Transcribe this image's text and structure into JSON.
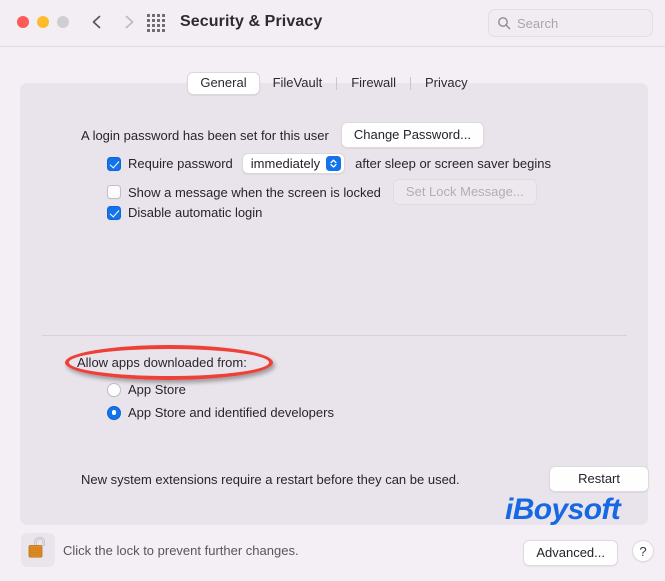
{
  "window": {
    "title": "Security & Privacy",
    "traffic_lights": [
      "close",
      "minimize",
      "zoom"
    ],
    "nav_back": "back-chevron",
    "nav_forward": "forward-chevron",
    "grid_button": "show-all-preferences",
    "search": {
      "placeholder": "Search",
      "value": "",
      "icon": "search-icon"
    }
  },
  "tabs": [
    {
      "label": "General",
      "selected": true
    },
    {
      "label": "FileVault",
      "selected": false
    },
    {
      "label": "Firewall",
      "selected": false
    },
    {
      "label": "Privacy",
      "selected": false
    }
  ],
  "general": {
    "login_password_text": "A login password has been set for this user",
    "change_password_button": "Change Password...",
    "require_password": {
      "checked": true,
      "label": "Require password",
      "delay_value": "immediately",
      "suffix": "after sleep or screen saver begins"
    },
    "show_message": {
      "checked": false,
      "label": "Show a message when the screen is locked",
      "button": "Set Lock Message...",
      "button_disabled": true
    },
    "disable_auto_login": {
      "checked": true,
      "label": "Disable automatic login"
    }
  },
  "gatekeeper": {
    "heading": "Allow apps downloaded from:",
    "highlight_color": "#ee4036",
    "options": [
      {
        "label": "App Store",
        "selected": false
      },
      {
        "label": "App Store and identified developers",
        "selected": true
      }
    ]
  },
  "extensions": {
    "text": "New system extensions require a restart before they can be used.",
    "restart_button": "Restart"
  },
  "watermark": {
    "text": "iBoysoft",
    "color": "#1668e3"
  },
  "footer": {
    "lock_icon": "unlocked-padlock-icon",
    "lock_text": "Click the lock to prevent further changes.",
    "advanced_button": "Advanced...",
    "help_button": "?"
  }
}
